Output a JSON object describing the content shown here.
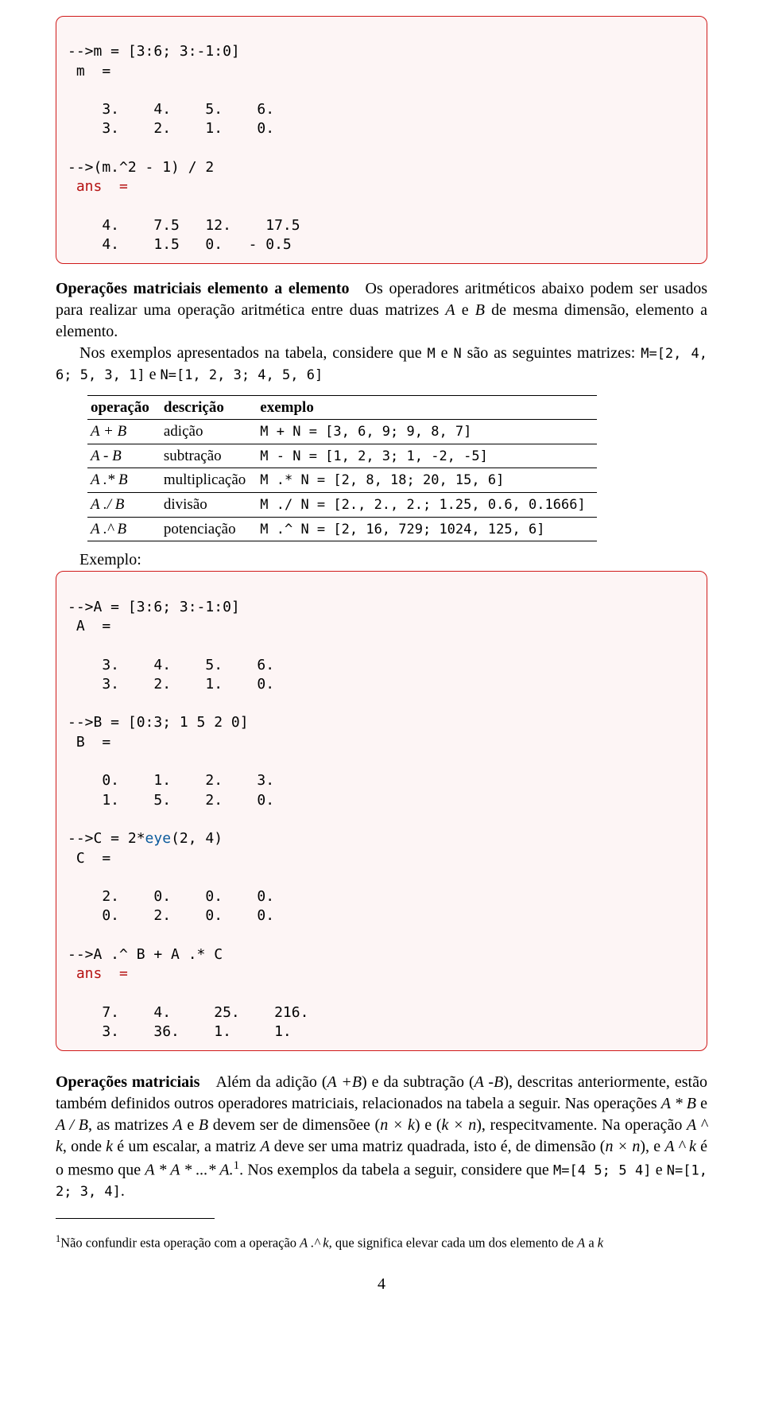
{
  "code1": {
    "l1": "-->m = [3:6; 3:-1:0]",
    "l2": " m  =",
    "l3": "    3.    4.    5.    6.",
    "l4": "    3.    2.    1.    0.",
    "l5": "-->(m.^2 - 1) / 2",
    "l6": " ans  =",
    "l7": "    4.    7.5   12.    17.5",
    "l8": "    4.    1.5   0.   - 0.5"
  },
  "sect1": {
    "title": "Operações matriciais elemento a elemento",
    "p1a": " Os operadores aritméticos abaixo podem ser usados para realizar uma operação aritmética entre duas matrizes ",
    "p1b": " e ",
    "p1c": " de mesma dimensão, elemento a elemento.",
    "p2a": "Nos exemplos apresentados na tabela, considere que ",
    "p2b": " e ",
    "p2c": " são as seguintes matrizes: ",
    "p2d": " e ",
    "Mdef": "M=[2, 4, 6; 5, 3, 1]",
    "Ndef": "N=[1, 2, 3; 4, 5, 6]",
    "Mtok": "M",
    "Ntok": "N"
  },
  "tbl": {
    "h1": "operação",
    "h2": "descrição",
    "h3": "exemplo",
    "rows": [
      {
        "op": "A + B",
        "d": "adição",
        "ex": "M + N = [3, 6, 9; 9, 8, 7]"
      },
      {
        "op": "A - B",
        "d": "subtração",
        "ex": "M - N = [1, 2, 3; 1, -2, -5]"
      },
      {
        "op": "A .* B",
        "d": "multiplicação",
        "ex": "M .* N = [2, 8, 18; 20, 15, 6]"
      },
      {
        "op": "A ./ B",
        "d": "divisão",
        "ex": "M ./ N = [2., 2., 2.; 1.25, 0.6, 0.1666]"
      },
      {
        "op": "A .^ B",
        "d": "potenciação",
        "ex": "M .^ N = [2, 16, 729; 1024, 125, 6]"
      }
    ]
  },
  "exemplo_label": "Exemplo:",
  "code2": {
    "l1": "-->A = [3:6; 3:-1:0]",
    "l2": " A  =",
    "l3": "    3.    4.    5.    6.",
    "l4": "    3.    2.    1.    0.",
    "l5": "-->B = [0:3; 1 5 2 0]",
    "l6": " B  =",
    "l7": "    0.    1.    2.    3.",
    "l8": "    1.    5.    2.    0.",
    "l9": "-->C = 2*eye(2, 4)",
    "l10": " C  =",
    "l11": "    2.    0.    0.    0.",
    "l12": "    0.    2.    0.    0.",
    "l13": "-->A .^ B + A .* C",
    "l14": " ans  =",
    "l15": "    7.    4.     25.    216.",
    "l16": "    3.    36.    1.     1."
  },
  "sect2": {
    "title": "Operações matriciais",
    "t1": " Além da adição (",
    "t2": ") e da subtração (",
    "t3": "), descritas anteriormente, estão também definidos outros operadores matriciais, relacionados na tabela a seguir. Nas operações ",
    "t4": " e ",
    "t5": ", as matrizes ",
    "t6": " e ",
    "t7": " devem ser de dimensõee (",
    "t8": ") e (",
    "t9": "), respecitvamente. Na operação ",
    "t10": ", onde ",
    "t11": " é um escalar, a matriz ",
    "t12": " deve ser uma matriz quadrada, isto é, de dimensão (",
    "t13": "), e ",
    "t14": " é o mesmo que ",
    "t15": ". Nos exemplos da tabela a seguir, considere que ",
    "t16": " e ",
    "t17": ".",
    "AplusB": "A  +B",
    "AminusB": "A  -B",
    "AstarB": "A * B",
    "AslashB": "A / B",
    "A": "A",
    "B": "B",
    "nk": "n × k",
    "kn": "k × n",
    "Acaretk": "A ^ k",
    "k": "k",
    "nn": "n × n",
    "AstarAstar": "A * A * ...* A.",
    "sup1": "1",
    "Mdef2": "M=[4 5; 5 4]",
    "Ndef2": "N=[1, 2; 3, 4]"
  },
  "footnote": {
    "n": "1",
    "a": "Não confundir esta operação com a operação ",
    "b": ", que significa elevar cada um dos elemento de ",
    "c": " a ",
    "Adotcaretk": "A .^ k",
    "A": "A",
    "k": "k"
  },
  "page_number": "4"
}
